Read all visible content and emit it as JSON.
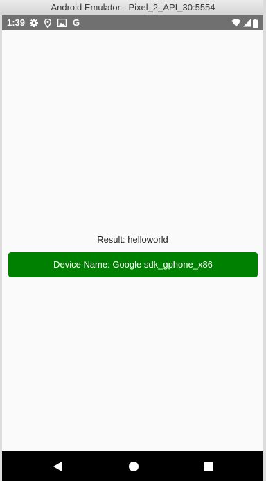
{
  "window": {
    "title": "Android Emulator - Pixel_2_API_30:5554"
  },
  "statusbar": {
    "time": "1:39",
    "left_icons": [
      "gear-icon",
      "location-pin-icon",
      "gallery-icon",
      "google-g-icon"
    ],
    "google_letter": "G",
    "right_icons": [
      "wifi-icon",
      "cell-signal-icon",
      "battery-icon"
    ]
  },
  "main": {
    "result_text": "Result: helloworld",
    "device_button_label": "Device Name: Google sdk_gphone_x86"
  },
  "navbar": {
    "buttons": [
      "back-icon",
      "home-icon",
      "recent-apps-icon"
    ]
  },
  "colors": {
    "statusbar": "#707070",
    "button_bg": "#008000",
    "button_text": "#ffffff",
    "content_bg": "#fafafa",
    "navbar": "#000000"
  }
}
